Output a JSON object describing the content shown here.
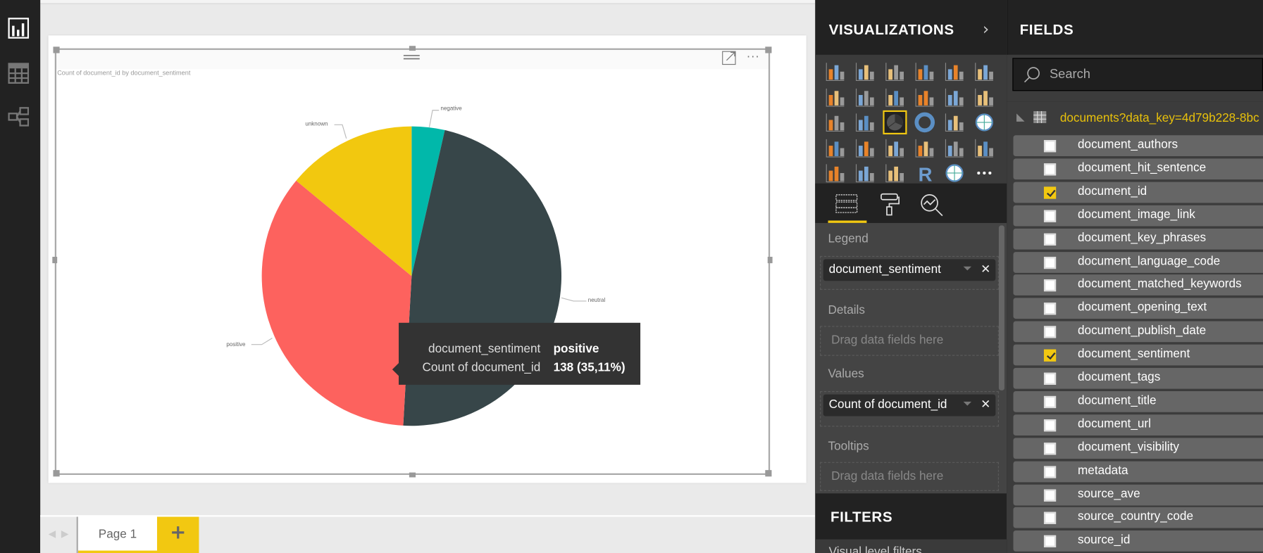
{
  "left_nav": {
    "items": [
      {
        "icon": "report-view-icon"
      },
      {
        "icon": "data-view-icon"
      },
      {
        "icon": "relationships-view-icon"
      }
    ]
  },
  "visual": {
    "title": "Count of document_id by document_sentiment",
    "tooltip": {
      "label1": "document_sentiment",
      "value1": "positive",
      "label2": "Count of document_id",
      "value2": "138 (35,11%)"
    }
  },
  "chart_data": {
    "type": "pie",
    "title": "Count of document_id by document_sentiment",
    "categories": [
      "negative",
      "neutral",
      "positive",
      "unknown"
    ],
    "values": [
      14,
      186,
      138,
      55
    ],
    "colors": [
      "#01b8aa",
      "#374649",
      "#fd625e",
      "#f2c80f"
    ],
    "legend": "none"
  },
  "page_tabs": {
    "tabs": [
      {
        "label": "Page 1",
        "active": true
      }
    ],
    "add_label": "+"
  },
  "visualizations": {
    "title": "VISUALIZATIONS",
    "selected": "pie-chart",
    "icons": [
      "stacked-bar",
      "stacked-column",
      "clustered-bar",
      "clustered-column",
      "100-stacked-bar",
      "100-stacked-column",
      "line",
      "area",
      "stacked-area",
      "line-clustered-column",
      "line-stacked-column",
      "ribbon",
      "waterfall",
      "scatter",
      "pie-chart",
      "donut",
      "treemap",
      "map",
      "filled-map",
      "funnel",
      "gauge",
      "card",
      "multi-row-card",
      "kpi",
      "slicer",
      "table",
      "matrix",
      "r-visual",
      "arcgis-map",
      "more"
    ],
    "tabs": [
      "fields-tab",
      "format-tab",
      "analytics-tab"
    ],
    "wells": {
      "legend_label": "Legend",
      "legend_value": "document_sentiment",
      "details_label": "Details",
      "details_placeholder": "Drag data fields here",
      "values_label": "Values",
      "values_value": "Count of document_id",
      "tooltips_label": "Tooltips",
      "tooltips_placeholder": "Drag data fields here"
    },
    "filters_title": "FILTERS",
    "filters_sub": "Visual level filters"
  },
  "fields": {
    "title": "FIELDS",
    "search_placeholder": "Search",
    "table_name": "documents?data_key=4d79b228-8bc",
    "items": [
      {
        "label": "document_authors",
        "checked": false
      },
      {
        "label": "document_hit_sentence",
        "checked": false
      },
      {
        "label": "document_id",
        "checked": true
      },
      {
        "label": "document_image_link",
        "checked": false
      },
      {
        "label": "document_key_phrases",
        "checked": false
      },
      {
        "label": "document_language_code",
        "checked": false
      },
      {
        "label": "document_matched_keywords",
        "checked": false
      },
      {
        "label": "document_opening_text",
        "checked": false
      },
      {
        "label": "document_publish_date",
        "checked": false
      },
      {
        "label": "document_sentiment",
        "checked": true
      },
      {
        "label": "document_tags",
        "checked": false
      },
      {
        "label": "document_title",
        "checked": false
      },
      {
        "label": "document_url",
        "checked": false
      },
      {
        "label": "document_visibility",
        "checked": false
      },
      {
        "label": "metadata",
        "checked": false
      },
      {
        "label": "source_ave",
        "checked": false
      },
      {
        "label": "source_country_code",
        "checked": false
      },
      {
        "label": "source_id",
        "checked": false
      }
    ]
  },
  "colors": {
    "accent": "#f2c811",
    "panel": "#222222"
  }
}
